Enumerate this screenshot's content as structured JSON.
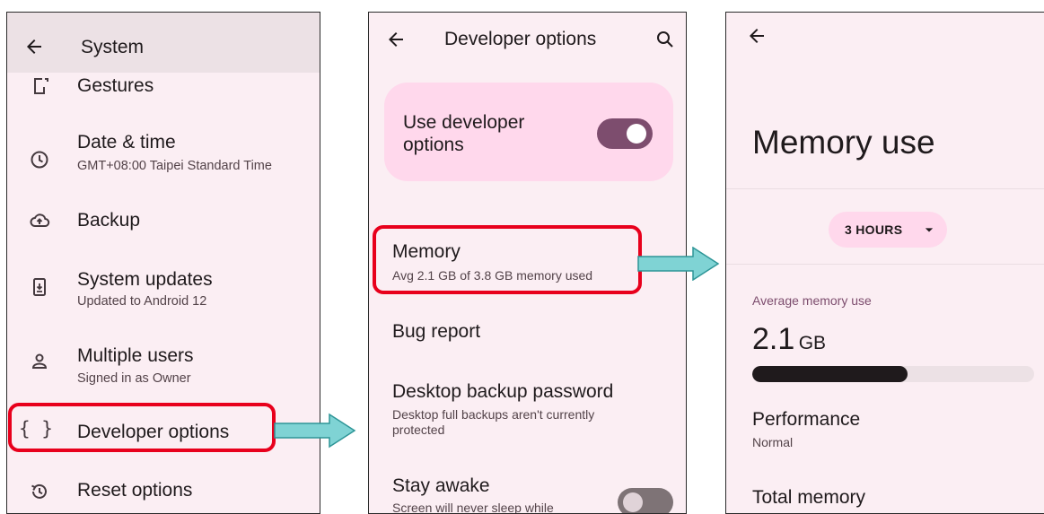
{
  "system": {
    "title": "System",
    "items": [
      {
        "label": "Gestures",
        "sub": "",
        "icon": "gestures-icon"
      },
      {
        "label": "Date & time",
        "sub": "GMT+08:00 Taipei Standard Time",
        "icon": "clock-icon"
      },
      {
        "label": "Backup",
        "sub": "",
        "icon": "cloud-upload-icon"
      },
      {
        "label": "System updates",
        "sub": "Updated to Android 12",
        "icon": "system-update-icon"
      },
      {
        "label": "Multiple users",
        "sub": "Signed in as Owner",
        "icon": "person-icon"
      },
      {
        "label": "Developer options",
        "sub": "",
        "icon": "braces-icon",
        "braces": "{ }"
      },
      {
        "label": "Reset options",
        "sub": "",
        "icon": "history-icon"
      }
    ]
  },
  "developer": {
    "title": "Developer options",
    "use_dev_label": "Use developer options",
    "use_dev_enabled": true,
    "memory": {
      "label": "Memory",
      "sub": "Avg 2.1 GB of 3.8 GB memory used"
    },
    "bug_report": "Bug report",
    "desktop_backup": {
      "label": "Desktop backup password",
      "sub": "Desktop full backups aren't currently protected"
    },
    "stay_awake": {
      "label": "Stay awake",
      "sub": "Screen will never sleep while",
      "enabled": false
    }
  },
  "memory_use": {
    "title": "Memory use",
    "range_button": "3 HOURS",
    "avg_label": "Average memory use",
    "avg_value": "2.1",
    "avg_unit": "GB",
    "usage_fraction": 0.55,
    "performance": {
      "label": "Performance",
      "value": "Normal"
    },
    "total_memory": "Total memory"
  },
  "colors": {
    "toggle_on": "#7d4d6e",
    "toggle_off": "#7e7376",
    "highlight": "#e8001c",
    "arrow_fill": "#7fd3d4"
  }
}
